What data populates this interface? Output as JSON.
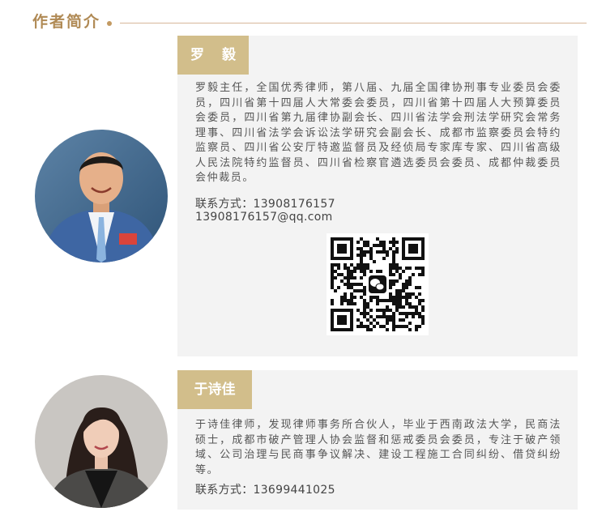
{
  "section": {
    "title": "作者简介"
  },
  "authors": [
    {
      "name": "罗 毅",
      "bio": "罗毅主任，全国优秀律师，第八届、九届全国律协刑事专业委员会委员，四川省第十四届人大常委会委员，四川省第十四届人大预算委员会委员，四川省第九届律协副会长、四川省法学会刑法学研究会常务理事、四川省法学会诉讼法学研究会副会长、成都市监察委员会特约监察员、四川省公安厅特邀监督员及经侦局专家库专家、四川省高级人民法院特约监督员、四川省检察官遴选委员会委员、成都仲裁委员会仲裁员。",
      "contact": "联系方式：13908176157",
      "email": "13908176157@qq.com"
    },
    {
      "name": "于诗佳",
      "bio": "于诗佳律师，发现律师事务所合伙人，毕业于西南政法大学，民商法硕士，成都市破产管理人协会监督和惩戒委员会委员，专注于破产领域、公司治理与民商事争议解决、建设工程施工合同纠纷、借贷纠纷等。",
      "contact": "联系方式：13699441025"
    }
  ],
  "colors": {
    "accent": "#b08a55",
    "name_tab": "#d2be8b",
    "card_bg": "#f3f3f3",
    "text": "#555555"
  },
  "icons": [
    "wechat-icon",
    "qr-code"
  ]
}
